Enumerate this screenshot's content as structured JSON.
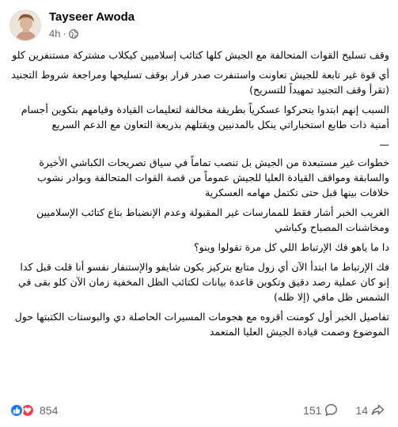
{
  "post": {
    "author": "Tayseer Awoda",
    "time": "4h",
    "separator": "·",
    "paragraphs": [
      "وقف تسليح القوات المتحالفة مع الجيش كلها كتائب إسلاميين كيكلاب مشتركة مستنفرين كلو",
      "أي قوة غير تابعة للجيش تعاونت واستنفرت صدر قرار بوقف تسليحها ومراجعة شروط التجنيد (تقرأ وقف التجنيد تمهيداً للتسريح)",
      "السبب إنهم ابتدوا يتحركوا عسكرياً بطريقة مخالفة لتعليمات القيادة وقيامهم بتكوين أجسام أمنية ذات طابع استخباراتي ينكل بالمدنيين ويقتلهم بذريعة التعاون مع الدعم السريع",
      "—",
      "خطوات غير مستبعدة من الجيش بل تنصب تماماً في سياق تصريحات الكباشي الأخيرة والسابقة ومواقف القيادة العليا للجيش عموماً من قصة القوات المتحالفة وبوادر نشوب خلافات بينها قبل حتى تكتمل مهامه العسكرية",
      "الغريب الخبر أشار فقط للممارسات غير المقبولة وعدم الإنضباط بتاع كتائب الإسلاميين ومخاشنات المصباح وكباشي",
      "دا ما ياهو فك الإرتباط اللي كل مرة تقولوا وينو؟",
      "فك الإرتباط ما ابتدأ الآن أي زول متابع بتركيز بكون شايفو والإستنفار نفسو أنا قلت قبل كدا إنو كان عملية رصد دقيق وتكوين قاعدة بيانات لكتائب الظل المخفية زمان الآن كلو بقى في الشمس ظل مافي (إلا ظله)",
      "تفاصيل الخبر أول كومنت أقروه مع هجومات المسيرات الحاصلة دي والبوستات الكتبتها حول الموضوع وصمت قيادة الجيش العليا المتعمد"
    ]
  },
  "footer": {
    "reactions_count": "854",
    "comments_count": "151",
    "shares_count": "14",
    "icons": [
      "like-icon",
      "love-icon",
      "comment-icon",
      "share-icon",
      "globe-icon"
    ],
    "colors": {
      "like": "#1877f2",
      "love": "#f33e58",
      "muted": "#65676b"
    }
  }
}
